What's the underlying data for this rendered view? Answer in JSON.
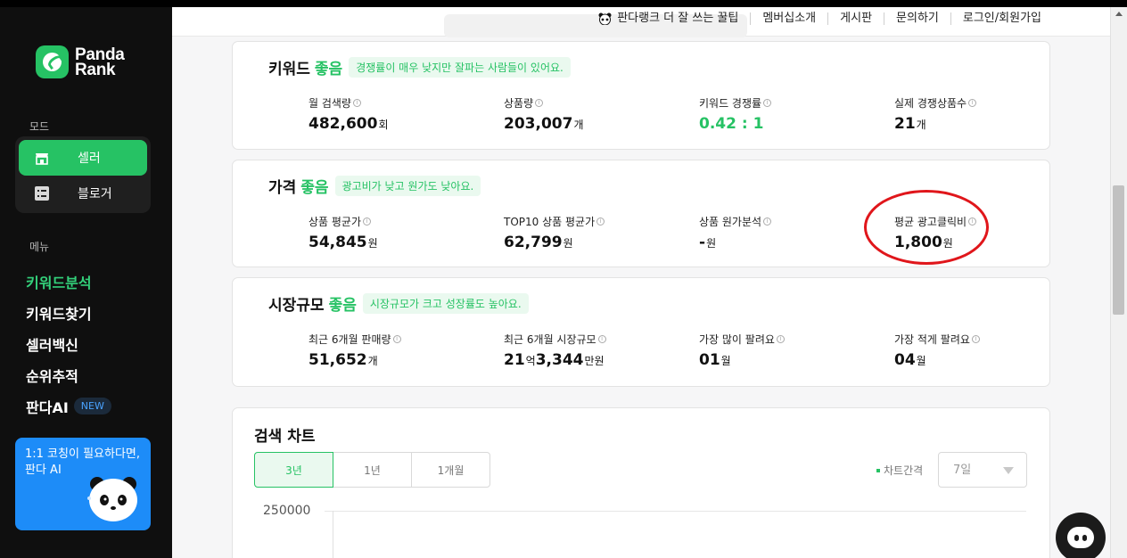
{
  "brand": {
    "name_line1": "Panda",
    "name_line2": "Rank",
    "color": "#26c264"
  },
  "sidebar": {
    "mode_label": "모드",
    "modes": [
      {
        "label": "셀러",
        "icon": "store-icon",
        "active": true
      },
      {
        "label": "블로거",
        "icon": "list-icon",
        "active": false
      }
    ],
    "menu_label": "메뉴",
    "menu": [
      {
        "label": "키워드분석",
        "active": true
      },
      {
        "label": "키워드찾기"
      },
      {
        "label": "셀러백신"
      },
      {
        "label": "순위추적"
      },
      {
        "label": "판다AI",
        "badge": "NEW"
      }
    ],
    "promo": {
      "line1": "1:1 코칭이 필요하다면,",
      "line2": "판다 AI"
    }
  },
  "header": {
    "nav": [
      "판다랭크 더 잘 쓰는 꿀팁",
      "멤버십소개",
      "게시판",
      "문의하기",
      "로그인/회원가입"
    ]
  },
  "cards": {
    "keyword": {
      "title": "키워드",
      "grade": "좋음",
      "pill": "경쟁률이 매우 낮지만 잘파는 사람들이 있어요.",
      "stats": [
        {
          "label": "월 검색량",
          "value": "482,600",
          "unit": "회"
        },
        {
          "label": "상품량",
          "value": "203,007",
          "unit": "개"
        },
        {
          "label": "키워드 경쟁률",
          "value": "0.42 : 1",
          "unit": ""
        },
        {
          "label": "실제 경쟁상품수",
          "value": "21",
          "unit": "개"
        }
      ]
    },
    "price": {
      "title": "가격",
      "grade": "좋음",
      "pill": "광고비가 낮고 원가도 낮아요.",
      "stats": [
        {
          "label": "상품 평균가",
          "value": "54,845",
          "unit": "원"
        },
        {
          "label": "TOP10 상품 평균가",
          "value": "62,799",
          "unit": "원"
        },
        {
          "label": "상품 원가분석",
          "value": "-",
          "unit": "원"
        },
        {
          "label": "평균 광고클릭비",
          "value": "1,800",
          "unit": "원"
        }
      ]
    },
    "market": {
      "title": "시장규모",
      "grade": "좋음",
      "pill": "시장규모가 크고 성장률도 높아요.",
      "stats": [
        {
          "label": "최근 6개월 판매량",
          "value": "51,652",
          "unit": "개"
        },
        {
          "label": "최근 6개월 시장규모",
          "value_a": "21",
          "unit_a": "억",
          "value_b": "3,344",
          "unit_b": "만원"
        },
        {
          "label": "가장 많이 팔려요",
          "value": "01",
          "unit": "월"
        },
        {
          "label": "가장 적게 팔려요",
          "value": "04",
          "unit": "월"
        }
      ]
    }
  },
  "chart": {
    "title": "검색 차트",
    "ranges": [
      "3년",
      "1년",
      "1개월"
    ],
    "active_range": "3년",
    "interval_label": "차트간격",
    "interval_value": "7일",
    "y_tick": "250000"
  }
}
